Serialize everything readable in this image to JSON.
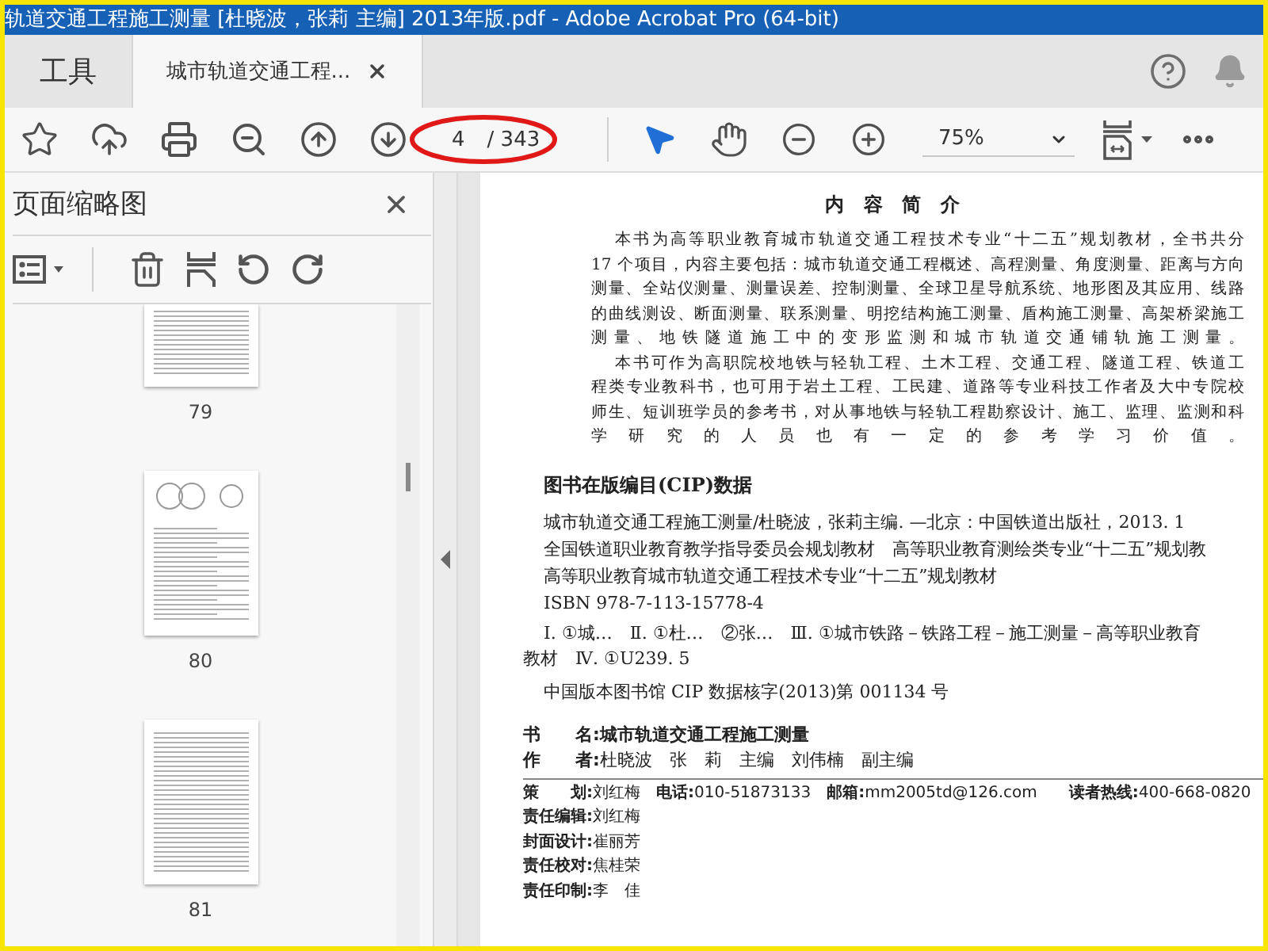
{
  "window": {
    "title": "轨道交通工程施工测量 [杜晓波，张莉 主编] 2013年版.pdf - Adobe Acrobat Pro (64-bit)"
  },
  "tabs": [
    {
      "label": "工具",
      "selected": false,
      "kind": "tools"
    },
    {
      "label": "城市轨道交通工程...",
      "selected": true,
      "kind": "document"
    }
  ],
  "toolbar": {
    "page_current": "4",
    "page_total": "/ 343",
    "zoom": "75%"
  },
  "thumbnails_panel": {
    "title": "页面缩略图",
    "pages": [
      {
        "label": "79"
      },
      {
        "label": "80"
      },
      {
        "label": "81"
      }
    ]
  },
  "document": {
    "heading": "内 容 简 介",
    "summary": [
      [
        "本书为高等职业教育城市轨道交通工程技术专业“十二五”规划教材，全书共分",
        "17 个项目，内容主要包括：城市轨道交通工程概述、高程测量、角度测量、距离与方向",
        "测量、全站仪测量、测量误差、控制测量、全球卫星导航系统、地形图及其应用、线路",
        "的曲线测设、断面测量、联系测量、明挖结构施工测量、盾构施工测量、高架桥梁施工",
        "测量、地铁隧道施工中的变形监测和城市轨道交通铺轨施工测量。"
      ],
      [
        "本书可作为高职院校地铁与轻轨工程、土木工程、交通工程、隧道工程、铁道工",
        "程类专业教科书，也可用于岩土工程、工民建、道路等专业科技工作者及大中专院校",
        "师生、短训班学员的参考书，对从事地铁与轻轨工程勘察设计、施工、监理、监测和科",
        "学研究的人员也有一定的参考学习价值。"
      ]
    ],
    "cip_heading": "图书在版编目(CIP)数据",
    "cip_lines": [
      "城市轨道交通工程施工测量/杜晓波，张莉主编. —北京：中国铁道出版社，2013. 1",
      "全国铁道职业教育教学指导委员会规划教材　高等职业教育测绘类专业“十二五”规划教",
      "高等职业教育城市轨道交通工程技术专业“十二五”规划教材",
      "ISBN 978-7-113-15778-4"
    ],
    "classification_lines": [
      "Ⅰ. ①城…　Ⅱ. ①杜…　②张…　Ⅲ. ①城市铁路－铁路工程－施工测量－高等职业教育",
      "教材　Ⅳ. ①U239. 5"
    ],
    "cip_number": "中国版本图书馆 CIP 数据核字(2013)第 001134 号",
    "credits": [
      {
        "kind": "title",
        "text": "书　　名:城市轨道交通工程施工测量"
      },
      {
        "kind": "entry",
        "text": "**作　　者:**杜晓波　张　莉　主编　刘伟楠　副主编"
      }
    ],
    "staff": [
      "**策　　划:**刘红梅　**电话:**010-51873133　**邮箱:**mm2005td@126.com　　**读者热线:**400-668-0820",
      "**责任编辑:**刘红梅",
      "**封面设计:**崔丽芳",
      "**责任校对:**焦桂荣",
      "**责任印制:**李　佳"
    ]
  }
}
